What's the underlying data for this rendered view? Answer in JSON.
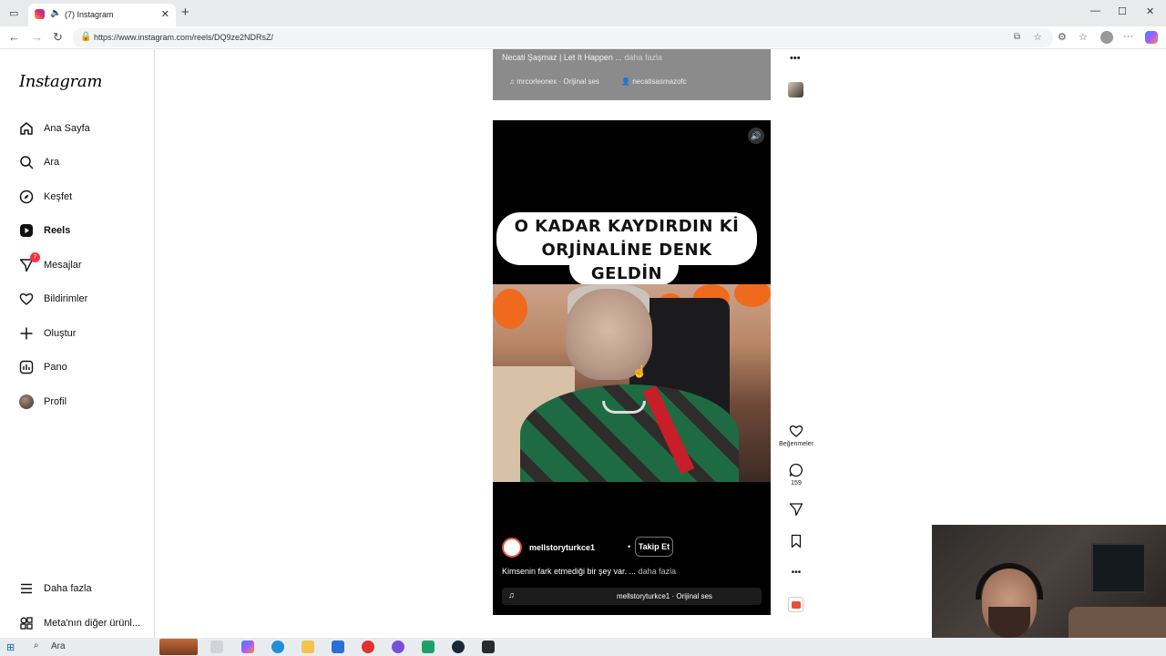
{
  "browser": {
    "tab_title": "(7) Instagram",
    "url": "https://www.instagram.com/reels/DQ9ze2NDRsZ/"
  },
  "sidebar": {
    "logo": "Instagram",
    "items": [
      {
        "label": "Ana Sayfa",
        "icon": "home-icon"
      },
      {
        "label": "Ara",
        "icon": "search-icon"
      },
      {
        "label": "Keşfet",
        "icon": "compass-icon"
      },
      {
        "label": "Reels",
        "icon": "reels-icon",
        "active": true
      },
      {
        "label": "Mesajlar",
        "icon": "messenger-icon",
        "badge": "7"
      },
      {
        "label": "Bildirimler",
        "icon": "heart-icon"
      },
      {
        "label": "Oluştur",
        "icon": "plus-icon"
      },
      {
        "label": "Pano",
        "icon": "dashboard-icon"
      },
      {
        "label": "Profil",
        "icon": "avatar-icon"
      }
    ],
    "more": "Daha fazla",
    "meta": "Meta'nın diğer ürünl..."
  },
  "prev_reel": {
    "caption": "Necati Şaşmaz | Let It Happen ...",
    "more": "daha fazla",
    "audio": "mrcorleonex · Orijinal ses",
    "user": "necatisasmazofc"
  },
  "reel": {
    "overlay_lines": [
      "O KADAR KAYDIRDIN Kİ",
      "ORJİNALİNE DENK",
      "GELDİN"
    ],
    "username": "mellstoryturkce1",
    "dot": "•",
    "follow": "Takip Et",
    "caption": "Kimsenin fark etmediği bir şey var. ...",
    "caption_more": "daha fazla",
    "audio": "mellstoryturkce1 · Orijinal ses"
  },
  "actions": {
    "likes_label": "Beğenmeler",
    "comments_count": "159"
  },
  "taskbar": {
    "search": "Ara"
  },
  "colors": {
    "accent_badge": "#ff3040",
    "reel_bg": "#000000"
  }
}
